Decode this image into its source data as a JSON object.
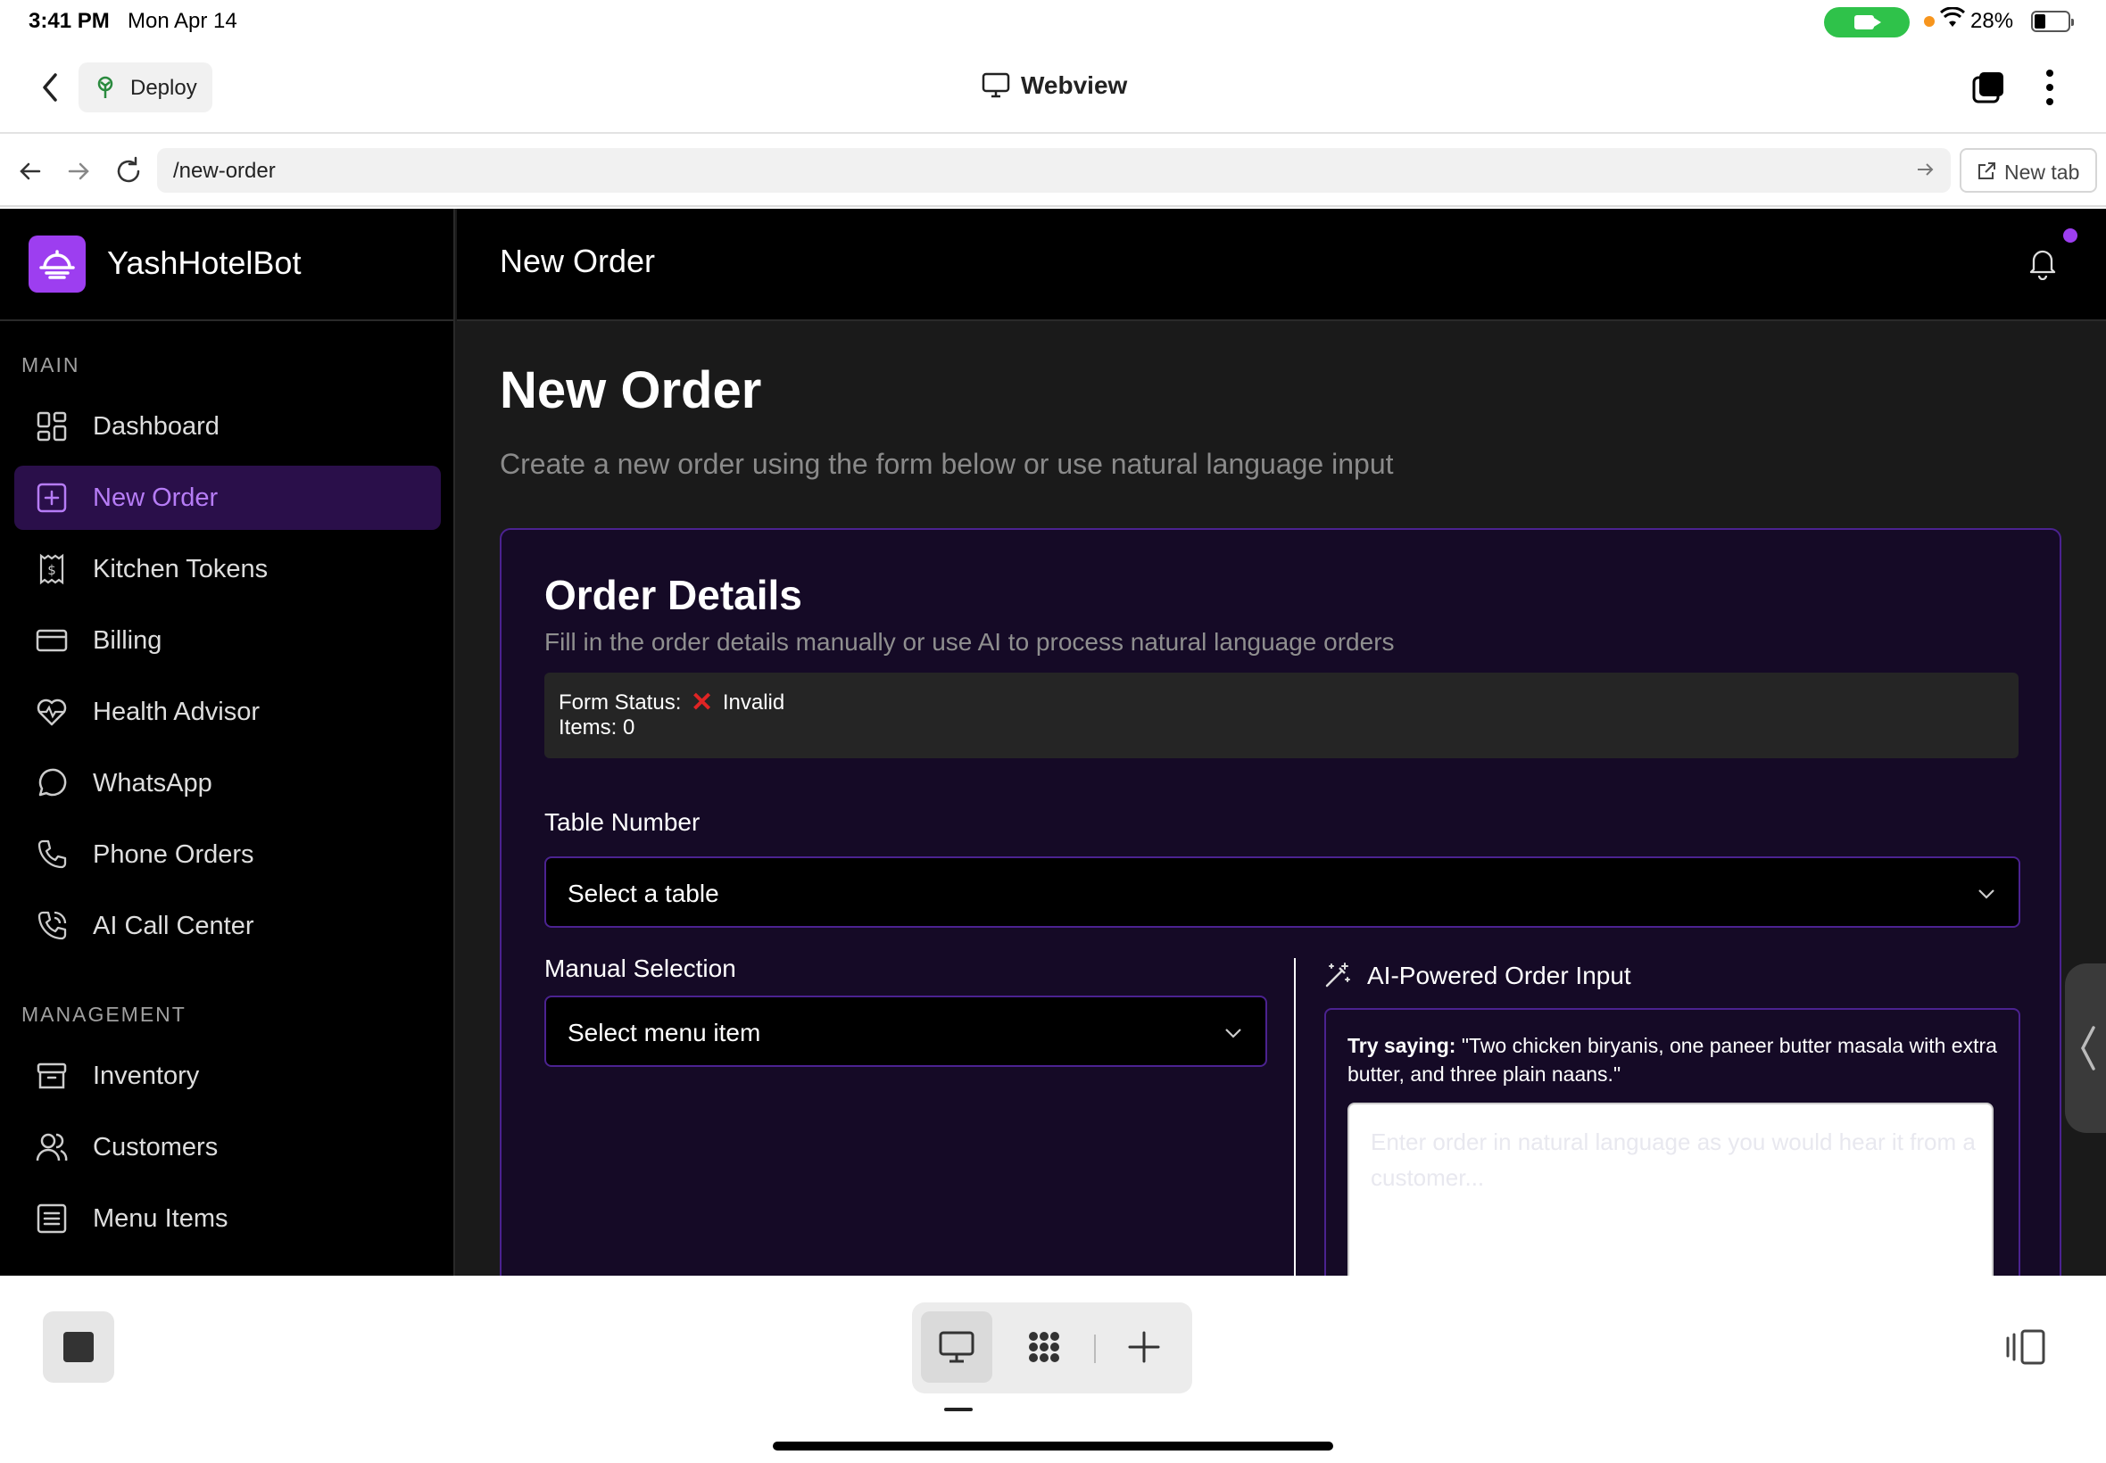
{
  "status_bar": {
    "time": "3:41 PM",
    "date": "Mon Apr 14",
    "battery": "28%"
  },
  "app_header": {
    "back_icon": "chevron-left-icon",
    "deploy_label": "Deploy",
    "title": "Webview"
  },
  "browser": {
    "url": "/new-order",
    "new_tab_label": "New tab"
  },
  "sidebar": {
    "brand": "YashHotelBot",
    "sections": [
      {
        "label": "MAIN"
      },
      {
        "label": "MANAGEMENT"
      }
    ],
    "items": [
      {
        "label": "Dashboard",
        "icon": "dashboard-icon"
      },
      {
        "label": "New Order",
        "icon": "plus-square-icon",
        "active": true
      },
      {
        "label": "Kitchen Tokens",
        "icon": "receipt-icon"
      },
      {
        "label": "Billing",
        "icon": "credit-card-icon"
      },
      {
        "label": "Health Advisor",
        "icon": "heart-pulse-icon"
      },
      {
        "label": "WhatsApp",
        "icon": "chat-bubble-icon"
      },
      {
        "label": "Phone Orders",
        "icon": "phone-icon"
      },
      {
        "label": "AI Call Center",
        "icon": "phone-call-icon"
      },
      {
        "label": "Inventory",
        "icon": "package-icon"
      },
      {
        "label": "Customers",
        "icon": "users-icon"
      },
      {
        "label": "Menu Items",
        "icon": "list-icon"
      }
    ]
  },
  "topbar": {
    "title": "New Order"
  },
  "main": {
    "title": "New Order",
    "subtitle": "Create a new order using the form below or use natural language input",
    "card": {
      "title": "Order Details",
      "subtitle": "Fill in the order details manually or use AI to process natural language orders",
      "form_status_label": "Form Status:",
      "form_status_value": "Invalid",
      "items_label": "Items: 0",
      "table_label": "Table Number",
      "table_value": "Select a table",
      "manual_label": "Manual Selection",
      "menu_value": "Select menu item",
      "ai_title": "AI-Powered Order Input",
      "ai_hint_prefix": "Try saying:",
      "ai_hint_text": " \"Two chicken biryanis, one paneer butter masala with extra butter, and three plain naans.\"",
      "ai_placeholder": "Enter order in natural language as you would hear it from a customer..."
    }
  },
  "colors": {
    "accent": "#9d3ef0",
    "active_bg": "#2a0f4a",
    "border": "#4b2290",
    "invalid": "#e02424"
  }
}
